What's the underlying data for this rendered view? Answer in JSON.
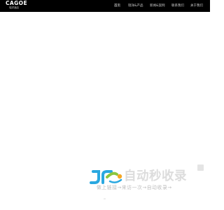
{
  "brand": {
    "name": "CAGOE",
    "subtitle": "瑞洋酒店"
  },
  "nav": {
    "items": [
      {
        "label": "首页",
        "active": true
      },
      {
        "label": "瑞洋&产品",
        "active": false
      },
      {
        "label": "新闻&案例",
        "active": false
      },
      {
        "label": "联系我们",
        "active": false
      },
      {
        "label": "关于我们",
        "active": false
      }
    ]
  },
  "badge": {
    "title": "自动秒收录",
    "tagline": "做上链接→来访一次→自动收录→",
    "logo_icon": "jr-logo-icon",
    "colors": {
      "blue": "#2aa8e0",
      "green": "#8cc63f",
      "orange": "#f5a623",
      "text": "#dcdcdc"
    }
  }
}
